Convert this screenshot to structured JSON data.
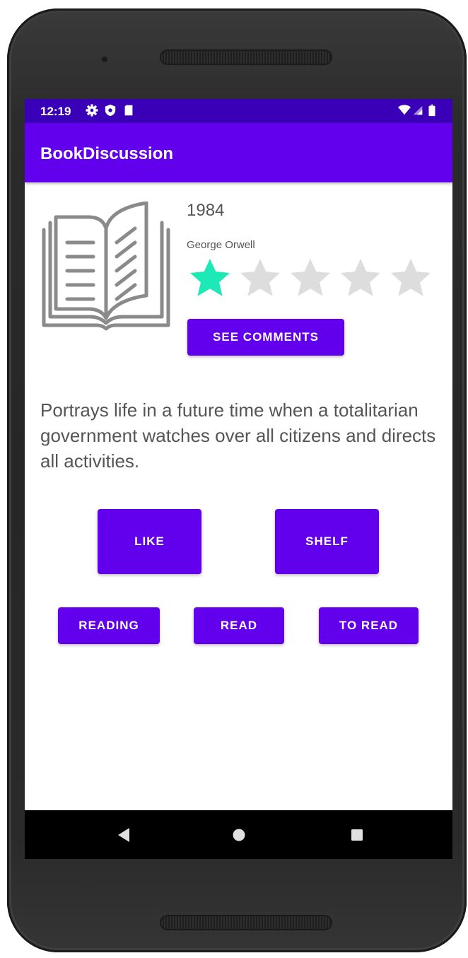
{
  "status_bar": {
    "time": "12:19",
    "icons": [
      "settings-icon",
      "shield-icon",
      "sim-card-icon",
      "wifi-icon",
      "signal-icon",
      "battery-icon"
    ]
  },
  "app_bar": {
    "title": "BookDiscussion",
    "color": "#6200ee",
    "status_color": "#3a00b8"
  },
  "book": {
    "icon": "open-book-icon",
    "title": "1984",
    "author": "George Orwell",
    "rating": 1,
    "max_rating": 5,
    "star_filled_color": "#1de9b6",
    "star_empty_color": "#dddddd",
    "see_comments_label": "SEE COMMENTS",
    "description": "Portrays life in a future time when a totalitarian government watches over all citizens and directs all activities."
  },
  "actions": {
    "like_label": "LIKE",
    "shelf_label": "SHELF",
    "reading_label": "READING",
    "read_label": "READ",
    "to_read_label": "TO READ"
  },
  "nav_bar": {
    "icons": [
      "back-icon",
      "home-icon",
      "recents-icon"
    ]
  }
}
